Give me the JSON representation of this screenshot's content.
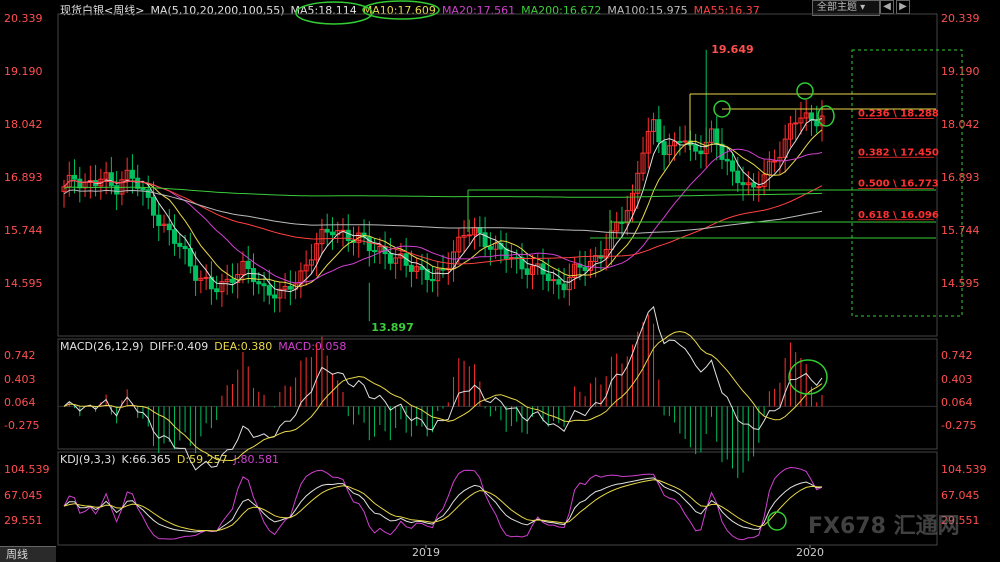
{
  "instrument": "现货白银",
  "period": "周线",
  "price_panel": {
    "indicator_labels": [
      {
        "text": "MA(5,10,20,200,100,55)",
        "color": "#e0e0e0"
      },
      {
        "text": "MA5:18.114",
        "color": "#e0e0e0"
      },
      {
        "text": "MA10:17.609",
        "color": "#e8d84a"
      },
      {
        "text": "MA20:17.561",
        "color": "#d040d0"
      },
      {
        "text": "MA200:16.672",
        "color": "#3ccc3c"
      },
      {
        "text": "MA100:15.975",
        "color": "#bbbbbb"
      },
      {
        "text": "MA55:16.37",
        "color": "#ff4040"
      }
    ],
    "y_ticks": [
      "20.339",
      "19.190",
      "18.042",
      "16.893",
      "15.744",
      "14.595"
    ],
    "high_label": "19.649",
    "low_label": "13.897",
    "fib_labels": [
      "0.236 \\ 18.288",
      "0.382 \\ 17.450",
      "0.500 \\ 16.773",
      "0.618 \\ 16.096"
    ]
  },
  "macd_panel": {
    "indicator_labels": [
      {
        "text": "MACD(26,12,9)",
        "color": "#e0e0e0"
      },
      {
        "text": "DIFF:0.409",
        "color": "#e0e0e0"
      },
      {
        "text": "DEA:0.380",
        "color": "#e8d84a"
      },
      {
        "text": "MACD:0.058",
        "color": "#d040d0"
      }
    ],
    "y_ticks": [
      "0.742",
      "0.403",
      "0.064",
      "-0.275"
    ]
  },
  "kdj_panel": {
    "indicator_labels": [
      {
        "text": "KDJ(9,3,3)",
        "color": "#e0e0e0"
      },
      {
        "text": "K:66.365",
        "color": "#e0e0e0"
      },
      {
        "text": "D:59.257",
        "color": "#e8d84a"
      },
      {
        "text": "J:80.581",
        "color": "#d040d0"
      }
    ],
    "y_ticks": [
      "104.539",
      "67.045",
      "29.551"
    ]
  },
  "x_ticks": [
    "2019",
    "2020"
  ],
  "theme_select": "全部主题",
  "watermark": "FX678 汇通网",
  "colors": {
    "up": "#ff3030",
    "down": "#00c060",
    "fib": "#ff3030",
    "fib_line": "#33cc33",
    "highlight": "#33cc33"
  },
  "chart_data": [
    {
      "type": "candlestick",
      "title": "现货白银 周线",
      "note": "Weekly candles, values approximated from chart; 144 bars",
      "closes_sampled": [
        16.6,
        16.9,
        16.8,
        16.7,
        16.9,
        16.6,
        17.0,
        16.8,
        16.5,
        16.2,
        15.8,
        15.5,
        15.3,
        14.9,
        14.6,
        14.4,
        14.6,
        14.8,
        14.9,
        14.7,
        14.5,
        14.4,
        14.3,
        14.6,
        14.9,
        15.3,
        15.6,
        15.8,
        15.7,
        15.5,
        15.5,
        15.4,
        15.3,
        15.0,
        15.1,
        15.0,
        14.8,
        14.6,
        14.9,
        15.3,
        15.6,
        15.7,
        15.6,
        15.4,
        15.2,
        15.1,
        15.0,
        14.9,
        14.8,
        14.6,
        14.6,
        14.8,
        14.9,
        15.1,
        15.3,
        15.6,
        16.0,
        16.5,
        17.5,
        18.0,
        17.5,
        17.6,
        17.8,
        17.3,
        17.6,
        17.9,
        17.3,
        16.9,
        16.9,
        16.6,
        16.8,
        17.2,
        17.6,
        18.0,
        18.2,
        18.1,
        18.3
      ],
      "y_range": [
        13.5,
        20.5
      ]
    },
    {
      "type": "line",
      "name": "MACD",
      "y_range": [
        -0.45,
        0.85
      ]
    },
    {
      "type": "line",
      "name": "KDJ",
      "y_range": [
        5,
        115
      ]
    }
  ]
}
